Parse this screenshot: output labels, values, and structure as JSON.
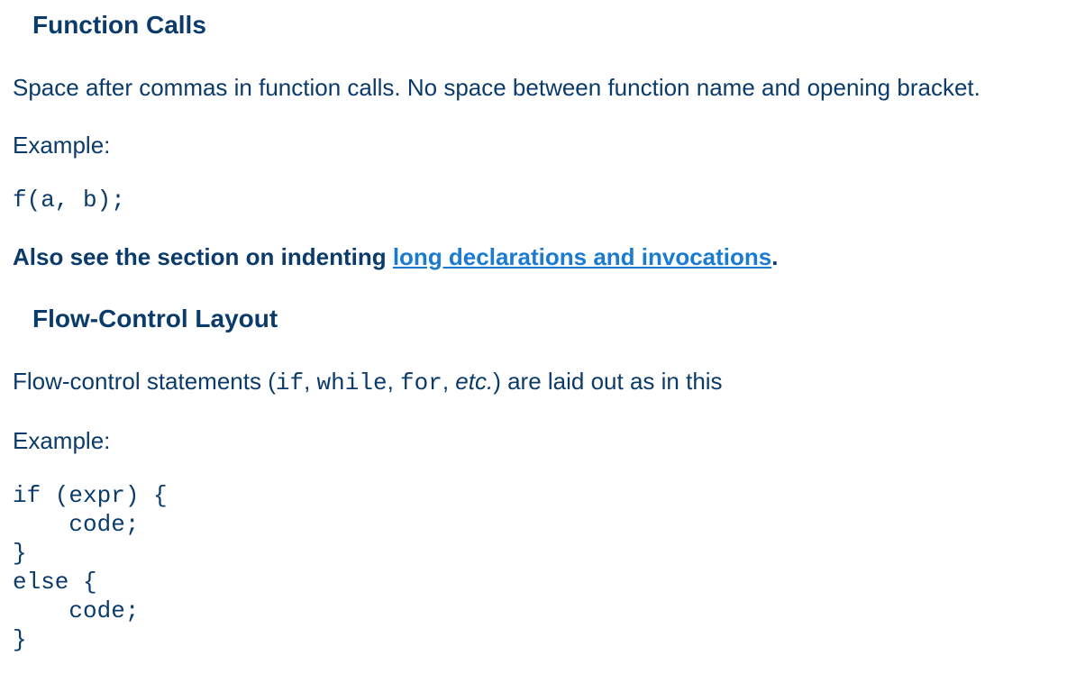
{
  "section1": {
    "heading": "Function Calls",
    "description": "Space after commas in function calls. No space between function name and opening bracket.",
    "example_label": "Example:",
    "code": "f(a, b);",
    "note_prefix": "Also see the section on indenting ",
    "note_link": "long declarations and invocations",
    "note_suffix": "."
  },
  "section2": {
    "heading": "Flow-Control Layout",
    "description_prefix": "Flow-control statements (",
    "kw_if": "if",
    "sep1": ", ",
    "kw_while": "while",
    "sep2": ", ",
    "kw_for": "for",
    "sep3": ", ",
    "etc": "etc.",
    "description_suffix": ") are laid out as in this",
    "example_label": "Example:",
    "code": "if (expr) {\n    code;\n}\nelse {\n    code;\n}"
  },
  "colors": {
    "text": "#0b3b6a",
    "link": "#1a7bd1",
    "background": "#ffffff"
  }
}
